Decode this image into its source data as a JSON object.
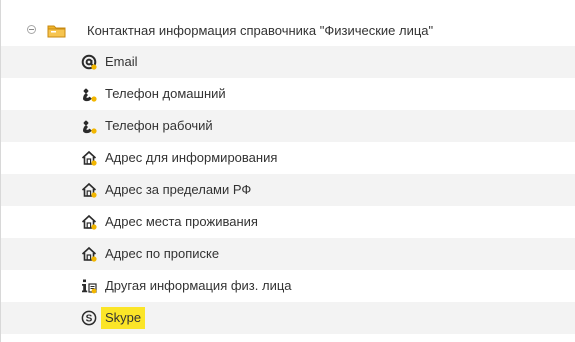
{
  "group": {
    "label": "Контактная информация справочника \"Физические лица\"",
    "icon": "folder-icon",
    "collapse_icon": "collapse-icon",
    "expanded": true
  },
  "items": [
    {
      "label": "Email",
      "icon": "email-at-icon",
      "selected": false
    },
    {
      "label": "Телефон домашний",
      "icon": "phone-icon",
      "selected": false
    },
    {
      "label": "Телефон рабочий",
      "icon": "phone-icon",
      "selected": false
    },
    {
      "label": "Адрес для информирования",
      "icon": "address-house-icon",
      "selected": false
    },
    {
      "label": "Адрес за пределами РФ",
      "icon": "address-house-icon",
      "selected": false
    },
    {
      "label": "Адрес места проживания",
      "icon": "address-house-icon",
      "selected": false
    },
    {
      "label": "Адрес по прописке",
      "icon": "address-house-icon",
      "selected": false
    },
    {
      "label": "Другая информация физ. лица",
      "icon": "other-info-icon",
      "selected": false
    },
    {
      "label": "Skype",
      "icon": "skype-icon",
      "selected": true
    }
  ],
  "colors": {
    "selection": "#fbe528",
    "row_shade": "#f3f3f3",
    "folder": "#f0b429",
    "icon_dark": "#2b2b2b",
    "icon_accent": "#f2b600"
  }
}
